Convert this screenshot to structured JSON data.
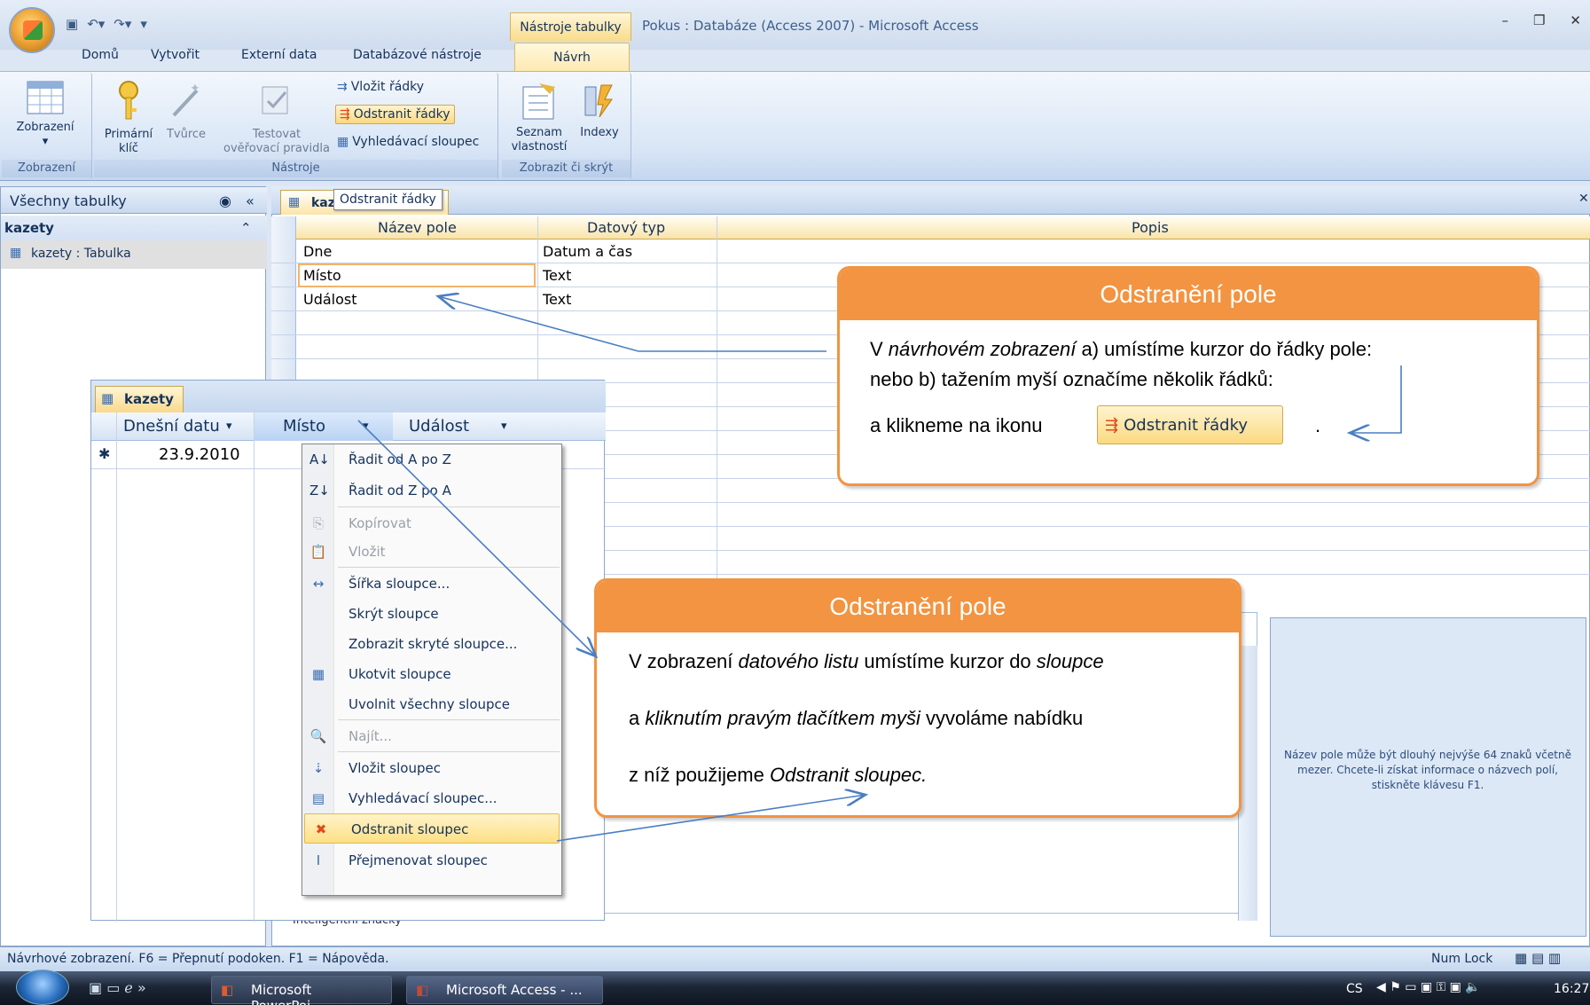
{
  "window": {
    "contextual_tab_group": "Nástroje tabulky",
    "title": "Pokus : Databáze (Access 2007) - Microsoft Access"
  },
  "ribbon_tabs": [
    "Domů",
    "Vytvořit",
    "Externí data",
    "Databázové nástroje",
    "Návrh"
  ],
  "ribbon": {
    "groups": {
      "zobrazeni": "Zobrazení",
      "nastroje": "Nástroje",
      "zobrazit_skryt": "Zobrazit či skrýt"
    },
    "buttons": {
      "zobrazeni": "Zobrazení",
      "primarni_klic_1": "Primární",
      "primarni_klic_2": "klíč",
      "tvurce": "Tvůrce",
      "testovat_1": "Testovat",
      "testovat_2": "ověřovací pravidla",
      "vlozit_radky": "Vložit řádky",
      "odstranit_radky": "Odstranit řádky",
      "vyhledavaci_sloupec": "Vyhledávací sloupec",
      "seznam_1": "Seznam",
      "seznam_2": "vlastností",
      "indexy": "Indexy"
    }
  },
  "nav_pane": {
    "header": "Všechny tabulky",
    "group": "kazety",
    "item": "kazety : Tabulka"
  },
  "document": {
    "tab": "kazety",
    "tooltip": "Odstranit řádky"
  },
  "design_grid": {
    "headers": [
      "Název pole",
      "Datový typ",
      "Popis"
    ],
    "rows": [
      {
        "name": "Dne",
        "type": "Datum a čas"
      },
      {
        "name": "Místo",
        "type": "Text"
      },
      {
        "name": "Událost",
        "type": "Text"
      }
    ],
    "lower_row_label": "Inteligentní značky",
    "help_text": "Název pole může být dlouhý nejvýše 64 znaků včetně mezer. Chcete-li získat informace o názvech polí, stiskněte klávesu F1."
  },
  "datasheet": {
    "tab": "kazety",
    "columns": [
      "Dnešní datu",
      "Místo",
      "Událost"
    ],
    "row_marker": "✱",
    "row_value": "23.9.2010"
  },
  "context_menu": [
    {
      "label": "Řadit od A po Z",
      "icon": "sort-az-icon",
      "disabled": false
    },
    {
      "label": "Řadit od Z po A",
      "icon": "sort-za-icon",
      "disabled": false
    },
    {
      "label": "Kopírovat",
      "icon": "copy-icon",
      "disabled": true
    },
    {
      "label": "Vložit",
      "icon": "paste-icon",
      "disabled": true
    },
    {
      "label": "Šířka sloupce...",
      "icon": "column-width-icon",
      "disabled": false
    },
    {
      "label": "Skrýt sloupce",
      "icon": "",
      "disabled": false
    },
    {
      "label": "Zobrazit skryté sloupce...",
      "icon": "",
      "disabled": false
    },
    {
      "label": "Ukotvit sloupce",
      "icon": "freeze-icon",
      "disabled": false
    },
    {
      "label": "Uvolnit všechny sloupce",
      "icon": "",
      "disabled": false
    },
    {
      "label": "Najít...",
      "icon": "find-icon",
      "disabled": true
    },
    {
      "label": "Vložit sloupec",
      "icon": "insert-column-icon",
      "disabled": false
    },
    {
      "label": "Vyhledávací sloupec...",
      "icon": "lookup-column-icon",
      "disabled": false
    },
    {
      "label": "Odstranit sloupec",
      "icon": "delete-column-icon",
      "disabled": false
    },
    {
      "label": "Přejmenovat sloupec",
      "icon": "rename-column-icon",
      "disabled": false
    }
  ],
  "callout1": {
    "title": "Odstranění pole",
    "l1a": "V ",
    "l1b": "návrhovém zobrazení",
    "l1c": " a) umístíme kurzor do řádky pole:",
    "l2": "nebo b) tažením myší označíme několik řádků:",
    "l3": "a klikneme na ikonu",
    "l3end": ".",
    "button": "Odstranit řádky"
  },
  "callout2": {
    "title": "Odstranění pole",
    "l1a": "V zobrazení ",
    "l1b": "datového listu",
    "l1c": " umístíme kurzor do ",
    "l1d": "sloupce",
    "l2a": "a ",
    "l2b": "kliknutím pravým tlačítkem myši",
    "l2c": " vyvoláme nabídku",
    "l3a": "z níž použijeme ",
    "l3b": "Odstranit sloupec."
  },
  "statusbar": {
    "text": "Návrhové zobrazení.  F6 = Přepnutí podoken.  F1 = Nápověda.",
    "numlock": "Num Lock"
  },
  "taskbar": {
    "items": [
      "Microsoft PowerPoi...",
      "Microsoft Access - ..."
    ],
    "lang": "CS",
    "clock": "16:27"
  },
  "colors": {
    "callout_accent": "#f29441",
    "ribbon_blue": "#dce6f4",
    "highlight": "#fddf85"
  }
}
